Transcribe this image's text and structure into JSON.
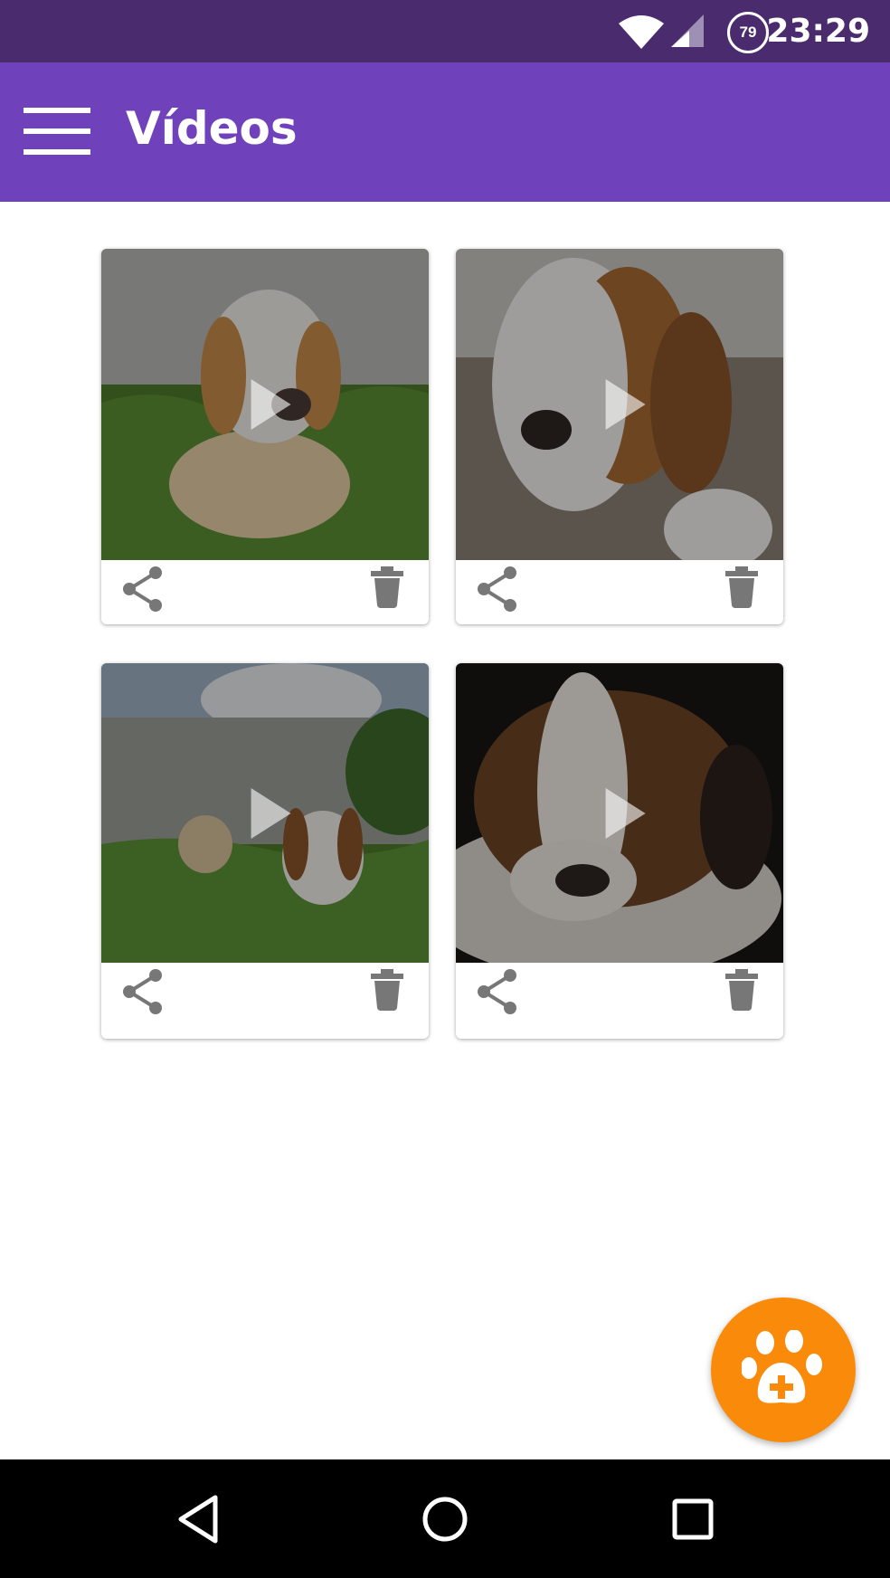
{
  "status_bar": {
    "time": "23:29",
    "battery_level": "79",
    "icons": [
      "wifi-icon",
      "cell-signal-icon",
      "battery-circle-icon"
    ]
  },
  "app_bar": {
    "title": "Vídeos",
    "menu_icon": "hamburger-menu-icon",
    "color": "#6f42bb"
  },
  "videos": [
    {
      "thumbnail": "beagle-puppy-on-grass",
      "actions": [
        "share-icon",
        "delete-icon"
      ]
    },
    {
      "thumbnail": "beagle-puppy-chewing-stick",
      "actions": [
        "share-icon",
        "delete-icon"
      ]
    },
    {
      "thumbnail": "two-beagles-in-yard",
      "actions": [
        "share-icon",
        "delete-icon"
      ]
    },
    {
      "thumbnail": "sleeping-beagle-puppy",
      "actions": [
        "share-icon",
        "delete-icon"
      ]
    }
  ],
  "fab": {
    "icon": "paw-plus-icon",
    "color": "#fa8a0a"
  },
  "nav_bar": {
    "icons": [
      "back-triangle-icon",
      "home-circle-icon",
      "recents-square-icon"
    ]
  }
}
